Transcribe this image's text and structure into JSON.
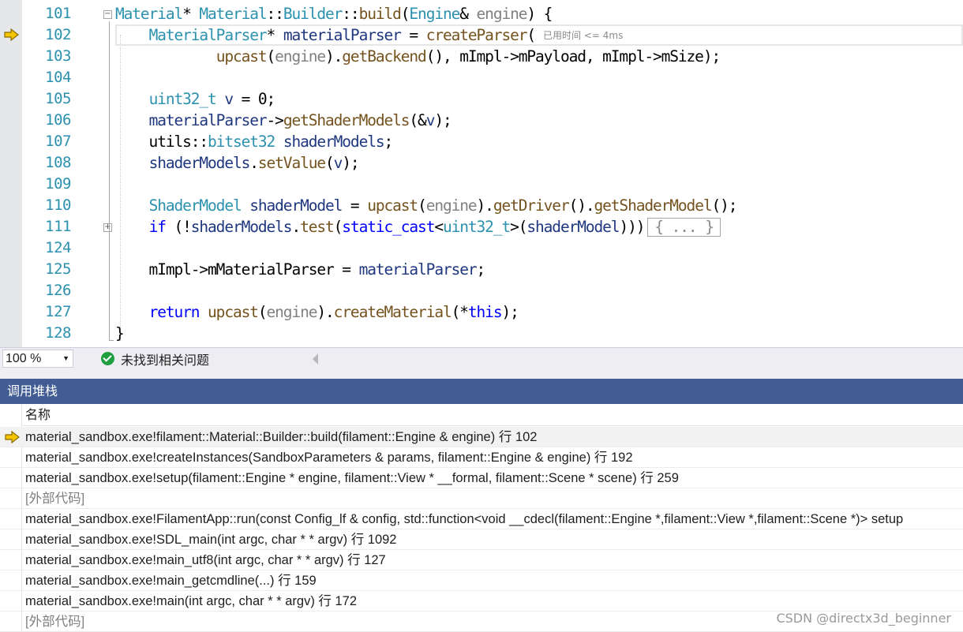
{
  "editor": {
    "line_numbers": [
      "101",
      "102",
      "103",
      "104",
      "105",
      "106",
      "107",
      "108",
      "109",
      "110",
      "111",
      "124",
      "125",
      "126",
      "127",
      "128"
    ],
    "elapsed_hint": "已用时间 <= 4ms",
    "collapsed_text": "{ ... }"
  },
  "status": {
    "zoom": "100 %",
    "issues": "未找到相关问题"
  },
  "callstack": {
    "title": "调用堆栈",
    "column_name": "名称",
    "rows": [
      "material_sandbox.exe!filament::Material::Builder::build(filament::Engine & engine) 行 102",
      "material_sandbox.exe!createInstances(SandboxParameters & params, filament::Engine & engine) 行 192",
      "material_sandbox.exe!setup(filament::Engine * engine, filament::View * __formal, filament::Scene * scene) 行 259",
      "[外部代码]",
      "material_sandbox.exe!FilamentApp::run(const Config_lf & config, std::function<void __cdecl(filament::Engine *,filament::View *,filament::Scene *)> setup",
      "material_sandbox.exe!SDL_main(int argc, char * * argv) 行 1092",
      "material_sandbox.exe!main_utf8(int argc, char * * argv) 行 127",
      "material_sandbox.exe!main_getcmdline(...) 行 159",
      "material_sandbox.exe!main(int argc, char * * argv) 行 172",
      "[外部代码]"
    ]
  },
  "watermark": "CSDN @directx3d_beginner",
  "colors": {
    "accent": "#425c94",
    "type": "#2b91af",
    "function": "#74531f",
    "keyword": "#0000ff",
    "arrow": "#f5c400"
  }
}
